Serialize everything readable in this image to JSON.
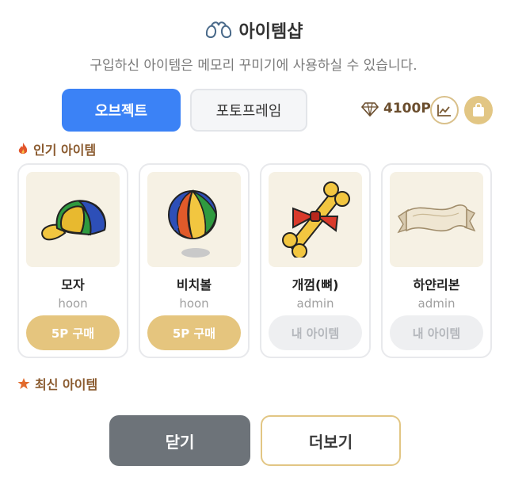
{
  "header": {
    "title": "아이템샵",
    "subtitle": "구입하신 아이템은 메모리 꾸미기에 사용하실 수 있습니다."
  },
  "tabs": [
    {
      "label": "오브젝트",
      "active": true
    },
    {
      "label": "포토프레임",
      "active": false
    }
  ],
  "wallet": {
    "points": "4100P",
    "icons": [
      "diamond-icon",
      "chart-icon",
      "shopping-bag-icon"
    ]
  },
  "sections": {
    "popular": "인기 아이템",
    "recent": "최신 아이템"
  },
  "items": [
    {
      "name": "모자",
      "author": "hoon",
      "action": "5P 구매",
      "icon": "cap-icon"
    },
    {
      "name": "비치볼",
      "author": "hoon",
      "action": "5P 구매",
      "icon": "beach-ball-icon"
    },
    {
      "name": "개껌(뼈)",
      "author": "admin",
      "action": "내 아이템",
      "icon": "dog-bone-icon"
    },
    {
      "name": "하얀리본",
      "author": "admin",
      "action": "내 아이템",
      "icon": "ribbon-banner-icon"
    }
  ],
  "buttons": {
    "close": "닫기",
    "more": "더보기"
  },
  "colors": {
    "primary": "#3b82f6",
    "gold": "#e5c57e",
    "muted": "#6d7379"
  }
}
